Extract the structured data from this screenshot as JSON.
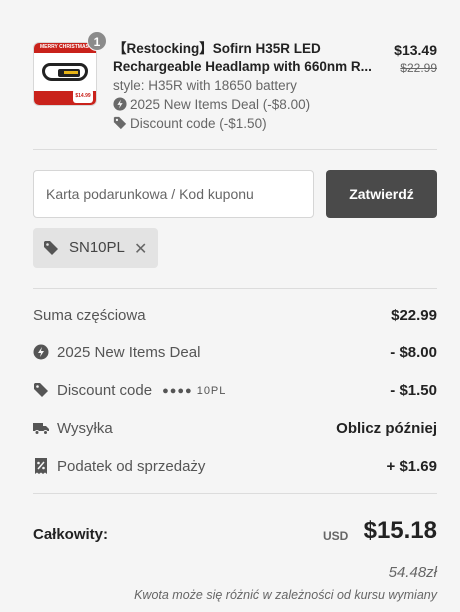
{
  "product": {
    "quantity": "1",
    "image_banner": "MERRY CHRISTMAS",
    "image_price": "$14.99",
    "title_line1": "【Restocking】Sofirn H35R LED",
    "title_line2": "Rechargeable Headlamp with 660nm R...",
    "style": "style: H35R with 18650 battery",
    "deal": "2025 New Items Deal (-$8.00)",
    "discount": "Discount code (-$1.50)",
    "price": "$13.49",
    "compare_price": "$22.99"
  },
  "coupon": {
    "placeholder": "Karta podarunkowa / Kod kuponu",
    "apply_label": "Zatwierdź",
    "applied_code": "SN10PL"
  },
  "summary": {
    "subtotal_label": "Suma częściowa",
    "subtotal_value": "$22.99",
    "deal_label": "2025 New Items Deal",
    "deal_value": "- $8.00",
    "discount_label": "Discount code",
    "discount_masked": "●●●● 10PL",
    "discount_value": "- $1.50",
    "shipping_label": "Wysyłka",
    "shipping_value": "Oblicz później",
    "tax_label": "Podatek od sprzedaży",
    "tax_value": "+ $1.69"
  },
  "total": {
    "label": "Całkowity:",
    "currency": "USD",
    "amount": "$15.18",
    "local_amount": "54.48zł",
    "note": "Kwota może się różnić w zależności od kursu wymiany"
  },
  "icons": {
    "deal": "bolt-icon",
    "discount": "tag-icon",
    "shipping": "truck-icon",
    "tax": "receipt-percent-icon",
    "remove": "close-icon"
  },
  "colors": {
    "background": "#f5f5f5",
    "button": "#4a4a4a",
    "chip": "#e3e3e3",
    "image_red": "#c9221b"
  }
}
